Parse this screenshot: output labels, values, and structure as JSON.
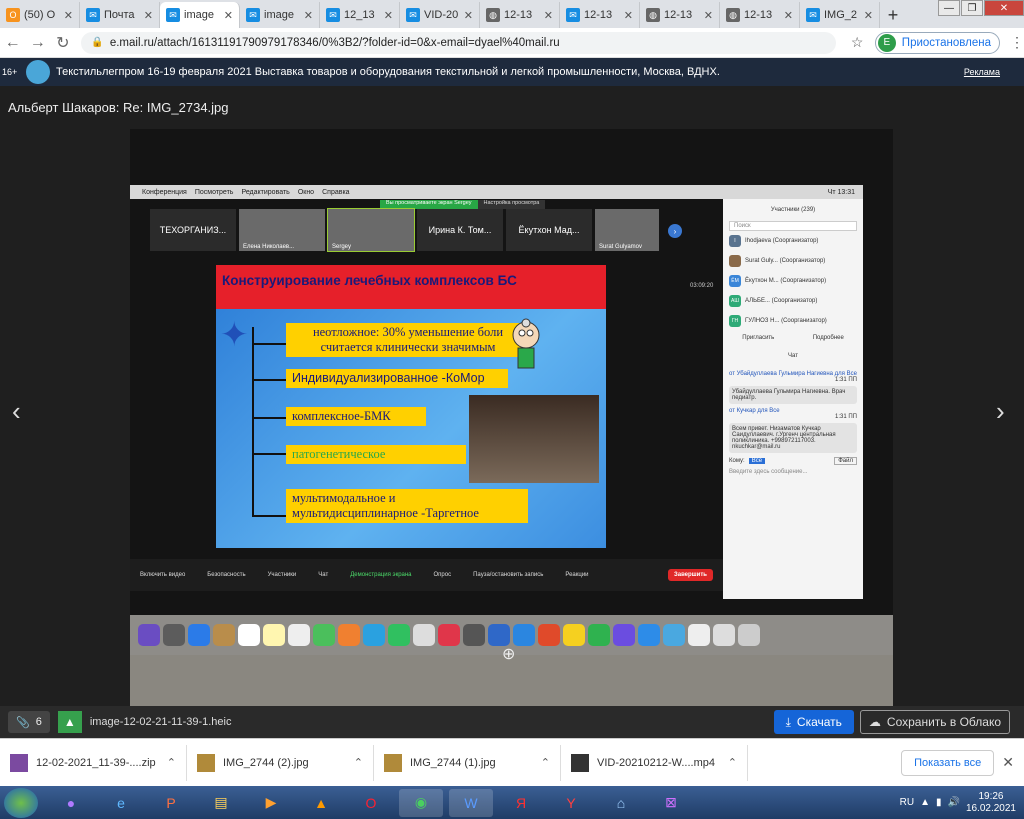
{
  "tabs": [
    {
      "label": "(50) O",
      "icon": "ok-icon"
    },
    {
      "label": "Почта",
      "icon": "mail-icon"
    },
    {
      "label": "image",
      "icon": "mail-icon"
    },
    {
      "label": "image",
      "icon": "mail-icon"
    },
    {
      "label": "12_13",
      "icon": "mail-icon"
    },
    {
      "label": "VID-20",
      "icon": "mail-icon"
    },
    {
      "label": "12-13",
      "icon": "globe-icon"
    },
    {
      "label": "12-13",
      "icon": "mail-icon"
    },
    {
      "label": "12-13",
      "icon": "globe-icon"
    },
    {
      "label": "12-13",
      "icon": "globe-icon"
    },
    {
      "label": "IMG_2",
      "icon": "mail-icon"
    }
  ],
  "address": {
    "url": "e.mail.ru/attach/16131191790979178346/0%3B2/?folder-id=0&x-email=dyael%40mail.ru",
    "profile_initial": "E",
    "profile_status": "Приостановлена"
  },
  "banner": {
    "age": "16+",
    "text": "Текстильлегпром 16-19 февраля 2021  Выставка товаров и оборудования текстильной и легкой промышленности, Москва, ВДНХ.",
    "ad_label": "Реклама"
  },
  "viewer": {
    "title": "Альберт Шакаров: Re: IMG_2734.jpg",
    "prev": "‹",
    "next": "›"
  },
  "photo": {
    "mac_menu": [
      "Конференция",
      "Посмотреть",
      "Редактировать",
      "Окно",
      "Справка"
    ],
    "mac_clock": "Чт 13:31",
    "share_notice": "Вы просматриваете экран Sergey",
    "view_settings": "Настройка просмотра",
    "tiles": [
      {
        "label": "ТЕХОРГАНИЗ...",
        "name": ""
      },
      {
        "label": "",
        "name": "Елена Николаев..."
      },
      {
        "label": "",
        "name": "Sergey"
      },
      {
        "label": "Ирина К. Том...",
        "name": ""
      },
      {
        "label": "Ёкутхон Мад...",
        "name": ""
      },
      {
        "label": "",
        "name": "Surat Gulyamov"
      }
    ],
    "timer": "03:09:20",
    "slide": {
      "title": "Конструирование лечебных комплексов БС",
      "items": [
        "неотложное: 30% уменьшение боли считается клинически значимым",
        "Индивидуализированное -КоМор",
        "комплексное-БМК",
        "патогенетическое",
        "мультимодальное и мультидисциплинарное -Таргетное"
      ]
    },
    "controls": [
      "Включить видео",
      "Безопасность",
      "Участники",
      "Чат",
      "Демонстрация экрана",
      "Опрос",
      "Пауза/остановить запись",
      "Реакции"
    ],
    "end_button": "Завершить",
    "participants_header": "Участники (239)",
    "search_placeholder": "Поиск",
    "participants": [
      {
        "initials": "I",
        "name": "Ihodjaeva (Соорганизатор)"
      },
      {
        "initials": "",
        "name": "Surat Guly... (Соорганизатор)"
      },
      {
        "initials": "ЁМ",
        "name": "Ёкутхон М... (Соорганизатор)"
      },
      {
        "initials": "АШ",
        "name": "АЛЬБЕ... (Соорганизатор)"
      },
      {
        "initials": "ГН",
        "name": "ГУЛНОЗ Н... (Соорганизатор)"
      }
    ],
    "invite": "Пригласить",
    "more": "Подробнее",
    "chat_header": "Чат",
    "chat": [
      {
        "from": "от Убайдуллаева Гульмира Нагиевна для Все",
        "time": "1:31 ПП",
        "text": "Убайдуллаева Гульмира Нагиевна. Врач педиатр."
      },
      {
        "from": "от Кучкар для Все",
        "time": "1:31 ПП",
        "text": "Всем привет. Низаматов Кучкар Саидуллаевич. г.Ургенч центральная поликлиника. +998972117003. nkuchkar@mail.ru"
      }
    ],
    "chat_to": "Кому:",
    "chat_to_value": "Все",
    "chat_file": "Файл",
    "chat_input": "Введите здесь сообщение..."
  },
  "attach": {
    "count": "6",
    "filename": "image-12-02-21-11-39-1.heic",
    "download": "Скачать",
    "cloud": "Сохранить в Облако"
  },
  "downloads": [
    {
      "name": "12-02-2021_11-39-....zip"
    },
    {
      "name": "IMG_2744 (2).jpg"
    },
    {
      "name": "IMG_2744 (1).jpg"
    },
    {
      "name": "VID-20210212-W....mp4"
    }
  ],
  "show_all": "Показать все",
  "taskbar": {
    "lang": "RU",
    "time": "19:26",
    "date": "16.02.2021"
  }
}
